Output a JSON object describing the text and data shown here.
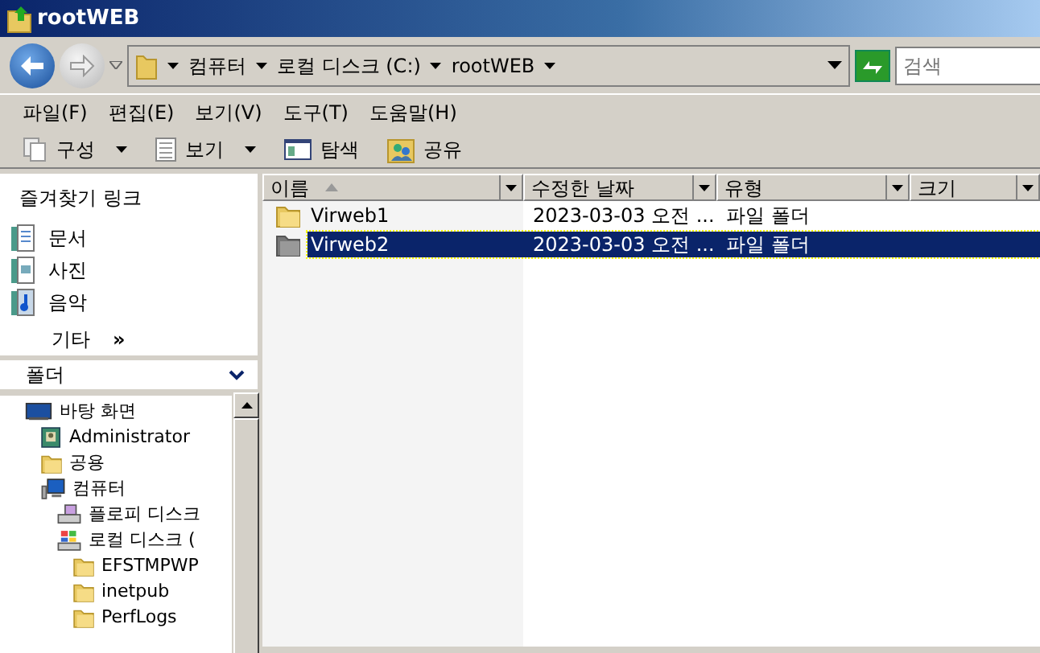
{
  "window": {
    "title": "rootWEB"
  },
  "address_bar": {
    "breadcrumbs": [
      "컴퓨터",
      "로컬 디스크 (C:)",
      "rootWEB"
    ]
  },
  "search": {
    "placeholder": "검색"
  },
  "menu": [
    "파일(F)",
    "편집(E)",
    "보기(V)",
    "도구(T)",
    "도움말(H)"
  ],
  "toolbar": [
    {
      "label": "구성",
      "kind": "organize",
      "dropdown": true
    },
    {
      "label": "보기",
      "kind": "views",
      "dropdown": true
    },
    {
      "label": "탐색",
      "kind": "explore",
      "dropdown": false
    },
    {
      "label": "공유",
      "kind": "share",
      "dropdown": false
    }
  ],
  "favorites": {
    "title": "즐겨찾기 링크",
    "items": [
      {
        "label": "문서",
        "kind": "documents"
      },
      {
        "label": "사진",
        "kind": "pictures"
      },
      {
        "label": "음악",
        "kind": "music"
      }
    ],
    "more": "기타",
    "more_mark": "»"
  },
  "folders": {
    "title": "폴더",
    "tree": [
      {
        "label": "바탕 화면",
        "kind": "desktop",
        "children": [
          {
            "label": "Administrator",
            "kind": "user"
          },
          {
            "label": "공용",
            "kind": "folder"
          },
          {
            "label": "컴퓨터",
            "kind": "computer",
            "children": [
              {
                "label": "플로피 디스크",
                "kind": "floppy"
              },
              {
                "label": "로컬 디스크 (",
                "kind": "drive",
                "children": [
                  {
                    "label": "EFSTMPWP",
                    "kind": "folder"
                  },
                  {
                    "label": "inetpub",
                    "kind": "folder"
                  },
                  {
                    "label": "PerfLogs",
                    "kind": "folder"
                  }
                ]
              }
            ]
          }
        ]
      }
    ]
  },
  "files": {
    "columns": [
      {
        "label": "이름",
        "sorted": true
      },
      {
        "label": "수정한 날짜",
        "sorted": false
      },
      {
        "label": "유형",
        "sorted": false
      },
      {
        "label": "크기",
        "sorted": false
      }
    ],
    "rows": [
      {
        "name": "Virweb1",
        "modified": "2023-03-03 오전 ...",
        "type": "파일 폴더",
        "selected": false
      },
      {
        "name": "Virweb2",
        "modified": "2023-03-03 오전 ...",
        "type": "파일 폴더",
        "selected": true
      }
    ]
  }
}
